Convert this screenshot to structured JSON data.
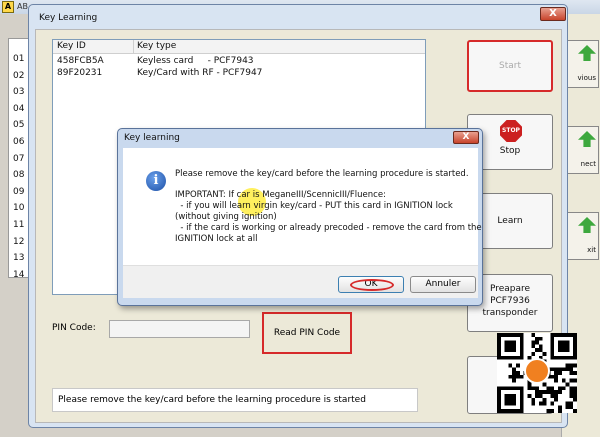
{
  "bg_app": {
    "logo": "A",
    "title": "AB",
    "grid_header": "#",
    "row_numbers": [
      "01",
      "02",
      "03",
      "04",
      "05",
      "06",
      "07",
      "08",
      "09",
      "10",
      "11",
      "12",
      "13",
      "14"
    ],
    "right_labels": [
      "vious",
      "nect",
      "xit"
    ]
  },
  "key_learning": {
    "title": "Key Learning",
    "close": "X",
    "list": {
      "headers": [
        "Key ID",
        "Key type"
      ],
      "rows": [
        {
          "id": "458FCB5A",
          "type": "Keyless card     - PCF7943"
        },
        {
          "id": "89F20231",
          "type": "Key/Card with RF - PCF7947"
        }
      ]
    },
    "buttons": {
      "start": "Start",
      "stop": "Stop",
      "stop_icon": "STOP",
      "learn": "Learn",
      "prepare": [
        "Preapare",
        "PCF7936",
        "transponder"
      ]
    },
    "pin_label": "PIN Code:",
    "pin_value": "",
    "read_pin": "Read PIN Code",
    "status": "Please remove the key/card before the learning procedure is started"
  },
  "dialog": {
    "title": "Key learning",
    "close": "X",
    "icon": "i",
    "lines": [
      "Please remove the key/card before the learning procedure is started.",
      "IMPORTANT: If car is MeganeIII/ScennicIII/Fluence:",
      "  - if you will learn virgin key/card - PUT this card in IGNITION lock",
      "(without giving ignition)",
      "  - if the card is working or already precoded - remove the card from the",
      "IGNITION lock at all"
    ],
    "ok": "OK",
    "cancel": "Annuler"
  },
  "colors": {
    "highlight_red": "#d62a2a",
    "info_blue": "#1c4fa6",
    "badge_orange": "#f08020"
  }
}
